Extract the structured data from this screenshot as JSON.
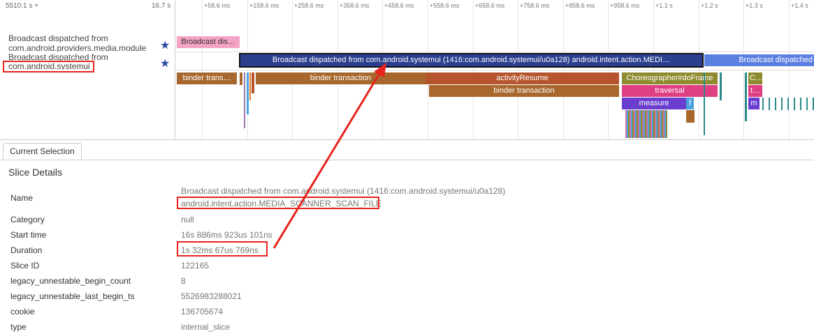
{
  "timeline": {
    "start_label": "5510.1 s +",
    "end_label": "16.7 s",
    "ticks": [
      "+58.6 ms",
      "+158.6 ms",
      "+258.6 ms",
      "+358.6 ms",
      "+458.6 ms",
      "+558.6 ms",
      "+658.6 ms",
      "+758.6 ms",
      "+858.6 ms",
      "+958.6 ms",
      "+1.1 s",
      "+1.2 s",
      "+1.3 s",
      "+1.4 s"
    ],
    "tracks": [
      {
        "title_line1": "Broadcast dispatched from",
        "title_line2": "com.android.providers.media.module"
      },
      {
        "title_line1": "Broadcast dispatched from",
        "title_line2": "com.android.systemui"
      }
    ],
    "slices": {
      "broadcast_small": "Broadcast dis…",
      "broadcast_selected": "Broadcast dispatched from com.android.systemui (1416:com.android.systemui/u0a128) android.intent.action.MEDI…",
      "broadcast_next": "Broadcast dispatched",
      "binder_trans_short": "binder trans…",
      "binder_transaction_1": "binder transaction",
      "activity_resume": "activityResume",
      "binder_transaction_2": "binder transaction",
      "choreographer": "Choreographer#doFrame",
      "traversal": "traversal",
      "measure": "measure",
      "f_short": "f",
      "c_short": "C…",
      "t_short": "t…",
      "m_short": "m"
    }
  },
  "details": {
    "tab_label": "Current Selection",
    "section_title": "Slice Details",
    "rows": [
      {
        "label": "Name",
        "value": "Broadcast dispatched from com.android.systemui (1416:com.android.systemui/u0a128)",
        "value2": "android.intent.action.MEDIA_SCANNER_SCAN_FILE"
      },
      {
        "label": "Category",
        "value": "null"
      },
      {
        "label": "Start time",
        "value": "16s 886ms 923us 101ns"
      },
      {
        "label": "Duration",
        "value": "1s 32ms 67us 769ns"
      },
      {
        "label": "Slice ID",
        "value": "122165"
      },
      {
        "label": "legacy_unnestable_begin_count",
        "value": "8"
      },
      {
        "label": "legacy_unnestable_last_begin_ts",
        "value": "5526983288021"
      },
      {
        "label": "cookie",
        "value": "136705674"
      },
      {
        "label": "type",
        "value": "internal_slice"
      }
    ]
  },
  "colors": {
    "selected_slice": "#2b3f8e",
    "broadcast_light": "#5b7fe0",
    "broadcast_pink": "#f4a3c4",
    "binder": "#a8672c",
    "activity": "#b5542d",
    "choreographer": "#8e8a2e",
    "traversal": "#df3f83",
    "measure": "#6a3fcf",
    "annotation_red": "#e8231d"
  }
}
